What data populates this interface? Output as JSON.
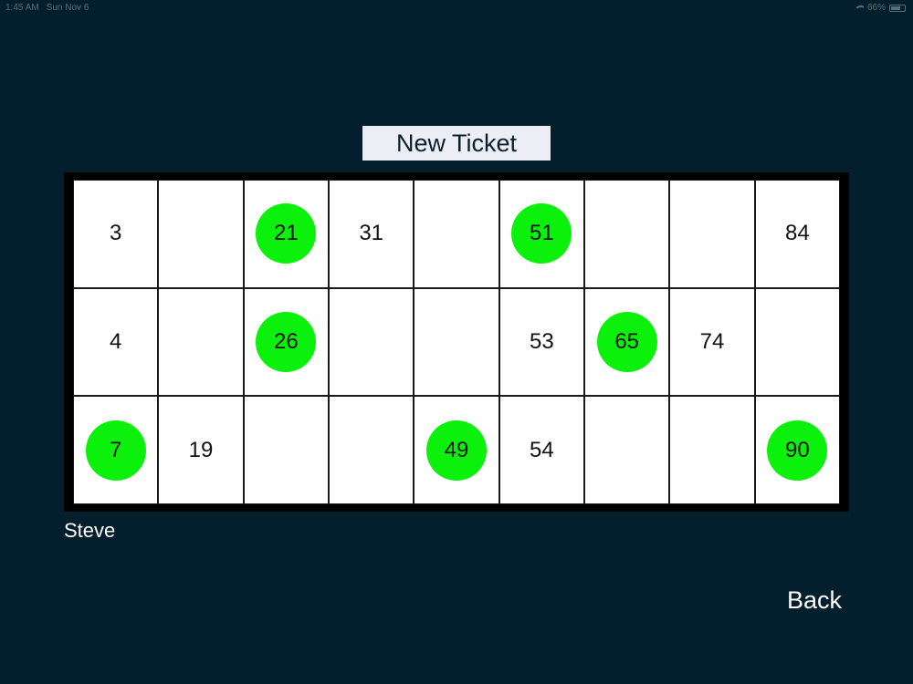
{
  "status_bar": {
    "time": "1:45 AM",
    "date": "Sun Nov 6",
    "battery": "66%"
  },
  "header": {
    "new_ticket_label": "New Ticket"
  },
  "ticket": {
    "player_name": "Steve",
    "marked_color": "#0bf10b",
    "rows": [
      [
        {
          "n": "3",
          "marked": false
        },
        {
          "n": "",
          "marked": false
        },
        {
          "n": "21",
          "marked": true
        },
        {
          "n": "31",
          "marked": false
        },
        {
          "n": "",
          "marked": false
        },
        {
          "n": "51",
          "marked": true
        },
        {
          "n": "",
          "marked": false
        },
        {
          "n": "",
          "marked": false
        },
        {
          "n": "84",
          "marked": false
        }
      ],
      [
        {
          "n": "4",
          "marked": false
        },
        {
          "n": "",
          "marked": false
        },
        {
          "n": "26",
          "marked": true
        },
        {
          "n": "",
          "marked": false
        },
        {
          "n": "",
          "marked": false
        },
        {
          "n": "53",
          "marked": false
        },
        {
          "n": "65",
          "marked": true
        },
        {
          "n": "74",
          "marked": false
        },
        {
          "n": "",
          "marked": false
        }
      ],
      [
        {
          "n": "7",
          "marked": true
        },
        {
          "n": "19",
          "marked": false
        },
        {
          "n": "",
          "marked": false
        },
        {
          "n": "",
          "marked": false
        },
        {
          "n": "49",
          "marked": true
        },
        {
          "n": "54",
          "marked": false
        },
        {
          "n": "",
          "marked": false
        },
        {
          "n": "",
          "marked": false
        },
        {
          "n": "90",
          "marked": true
        }
      ]
    ]
  },
  "footer": {
    "back_label": "Back"
  }
}
